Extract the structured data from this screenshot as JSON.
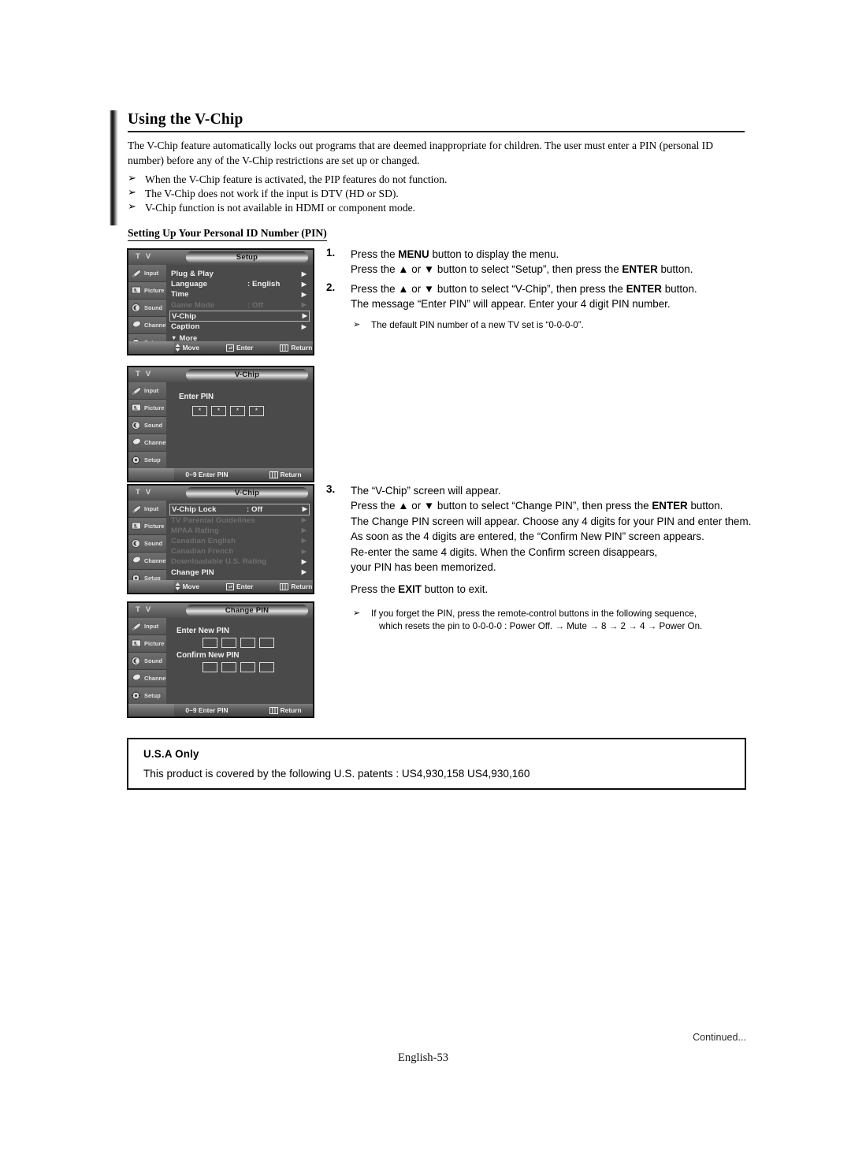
{
  "document": {
    "title": "Using the V-Chip",
    "intro": "The V-Chip feature automatically locks out programs that are deemed inappropriate for children. The user must enter a PIN (personal ID number) before any of the V-Chip restrictions are set up or changed.",
    "bullets": [
      "When the V-Chip feature is activated, the PIP features do not function.",
      "The V-Chip does not work if the input is DTV (HD or SD).",
      "V-Chip function is not available in HDMI or component mode."
    ],
    "subheading": "Setting Up Your Personal ID Number (PIN)",
    "arrow_glyph": "➢"
  },
  "osd_common": {
    "tv_label": "T V",
    "side_items": [
      {
        "label": "Input",
        "icon": "input-icon"
      },
      {
        "label": "Picture",
        "icon": "picture-icon"
      },
      {
        "label": "Sound",
        "icon": "sound-icon"
      },
      {
        "label": "Channel",
        "icon": "channel-icon"
      },
      {
        "label": "Setup",
        "icon": "setup-icon"
      }
    ],
    "hints": {
      "move": "Move",
      "enter": "Enter",
      "return": "Return",
      "enter_pin": "0~9 Enter PIN"
    },
    "bg_color": "#4a4a4a",
    "text_color": "#f2f2f2",
    "dim_color": "#6f6f6f"
  },
  "osd_setup": {
    "title": "Setup",
    "rows": [
      {
        "label": "Plug & Play",
        "value": "",
        "arrow": "▶",
        "state": "normal"
      },
      {
        "label": "Language",
        "value": ": English",
        "arrow": "▶",
        "state": "normal"
      },
      {
        "label": "Time",
        "value": "",
        "arrow": "▶",
        "state": "normal"
      },
      {
        "label": "Game Mode",
        "value": ": Off",
        "arrow": "▶",
        "state": "dim"
      },
      {
        "label": "V-Chip",
        "value": "",
        "arrow": "▶",
        "state": "selected"
      },
      {
        "label": "Caption",
        "value": "",
        "arrow": "▶",
        "state": "normal"
      }
    ],
    "more_label": "More",
    "more_glyph": "▼"
  },
  "osd_enter_pin": {
    "title": "V-Chip",
    "prompt": "Enter PIN",
    "digits": [
      "*",
      "*",
      "*",
      "*"
    ]
  },
  "osd_vchip": {
    "title": "V-Chip",
    "rows": [
      {
        "label": "V-Chip Lock",
        "value": ": Off",
        "arrow": "▶",
        "state": "selected"
      },
      {
        "label": "TV Parental Guidelines",
        "value": "",
        "arrow": "▶",
        "state": "dim"
      },
      {
        "label": "MPAA Rating",
        "value": "",
        "arrow": "▶",
        "state": "dim"
      },
      {
        "label": "Canadian English",
        "value": "",
        "arrow": "▶",
        "state": "dim"
      },
      {
        "label": "Canadian French",
        "value": "",
        "arrow": "▶",
        "state": "dim"
      },
      {
        "label": "Downloadable U.S. Rating",
        "value": "",
        "arrow": "▶",
        "state": "dim-bright-arrow"
      },
      {
        "label": "Change PIN",
        "value": "",
        "arrow": "▶",
        "state": "normal"
      }
    ]
  },
  "osd_change_pin": {
    "title": "Change PIN",
    "enter_label": "Enter New PIN",
    "confirm_label": "Confirm New PIN",
    "enter_digits": [
      "",
      "",
      "",
      ""
    ],
    "confirm_digits": [
      "",
      "",
      "",
      ""
    ]
  },
  "instructions": {
    "step1": {
      "num": "1.",
      "line1_a": "Press the ",
      "line1_b": "MENU",
      "line1_c": " button to display the menu.",
      "line2_a": "Press the ",
      "line2_b": "▲",
      "line2_c": " or ",
      "line2_d": "▼",
      "line2_e": " button to select “Setup”, then press the ",
      "line2_f": "ENTER",
      "line2_g": " button."
    },
    "step2": {
      "num": "2.",
      "line1_a": "Press the ",
      "line1_b": "▲",
      "line1_c": " or ",
      "line1_d": "▼",
      "line1_e": " button to select “V-Chip”, then press the ",
      "line1_f": "ENTER",
      "line1_g": " button.",
      "line2": "The message “Enter PIN” will appear. Enter your 4 digit PIN number.",
      "note": "The default PIN number of a new TV set is “0-0-0-0”."
    },
    "step3": {
      "num": "3.",
      "line1": "The “V-Chip” screen will appear.",
      "line2_a": "Press the ",
      "line2_b": "▲",
      "line2_c": " or ",
      "line2_d": "▼",
      "line2_e": " button to select “Change PIN”, then press the ",
      "line2_f": "ENTER",
      "line2_g": " button.",
      "line3": "The Change PIN screen will appear. Choose any 4 digits for your PIN and enter them.",
      "line4": "As soon as the 4 digits are entered, the “Confirm New PIN” screen appears.",
      "line5": "Re-enter the same 4 digits. When the Confirm screen disappears,",
      "line6": "your PIN has been memorized.",
      "exit_a": "Press the ",
      "exit_b": "EXIT",
      "exit_c": " button to exit.",
      "note_line1": "If you forget the PIN, press the remote-control buttons in the following sequence,",
      "note_line2": "which resets the pin to 0-0-0-0 : Power Off. → Mute → 8 → 2 → 4 → Power On."
    }
  },
  "usa_box": {
    "heading": "U.S.A Only",
    "body": "This product is covered by the following U.S. patents : US4,930,158 US4,930,160"
  },
  "footer": {
    "continued": "Continued...",
    "page": "English-53"
  }
}
